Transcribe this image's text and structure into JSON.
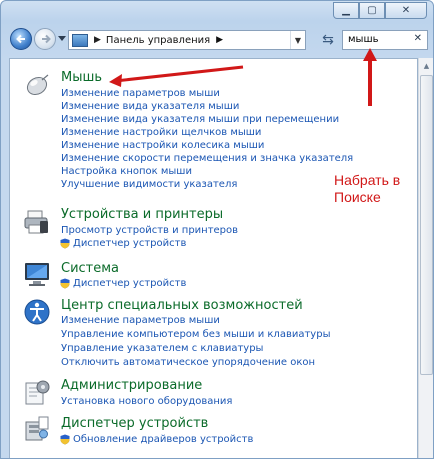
{
  "address_bar": {
    "breadcrumb": "Панель управления"
  },
  "search": {
    "value": "мышь",
    "clear_icon": "close-icon"
  },
  "groups": [
    {
      "title": "Мышь",
      "icon": "mouse-icon",
      "items": [
        "Изменение параметров мыши",
        "Изменение вида указателя мыши",
        "Изменение вида указателя мыши при перемещении",
        "Изменение настройки щелчков мыши",
        "Изменение настройки колесика мыши",
        "Изменение скорости перемещения и значка указателя",
        "Настройка кнопок мыши",
        "Улучшение видимости указателя"
      ]
    },
    {
      "title": "Устройства и принтеры",
      "icon": "printer-icon",
      "items": [
        "Просмотр устройств и принтеров",
        "Диспетчер устройств"
      ]
    },
    {
      "title": "Система",
      "icon": "computer-icon",
      "items": [
        "Диспетчер устройств"
      ]
    },
    {
      "title": "Центр специальных возможностей",
      "icon": "accessibility-icon",
      "items": [
        "Изменение параметров мыши",
        "Управление компьютером без мыши и клавиатуры",
        "Управление указателем с клавиатуры",
        "Отключить автоматическое упорядочение окон"
      ]
    },
    {
      "title": "Администрирование",
      "icon": "admin-tools-icon",
      "items": [
        "Установка нового оборудования"
      ]
    },
    {
      "title": "Диспетчер устройств",
      "icon": "device-manager-icon",
      "items": [
        "Обновление драйверов устройств"
      ]
    }
  ],
  "annotation": {
    "line1": "Набрать в",
    "line2": "Поиске",
    "color": "#d11818"
  },
  "colors": {
    "group_title": "#0b6b2a",
    "link": "#1b56b3"
  }
}
